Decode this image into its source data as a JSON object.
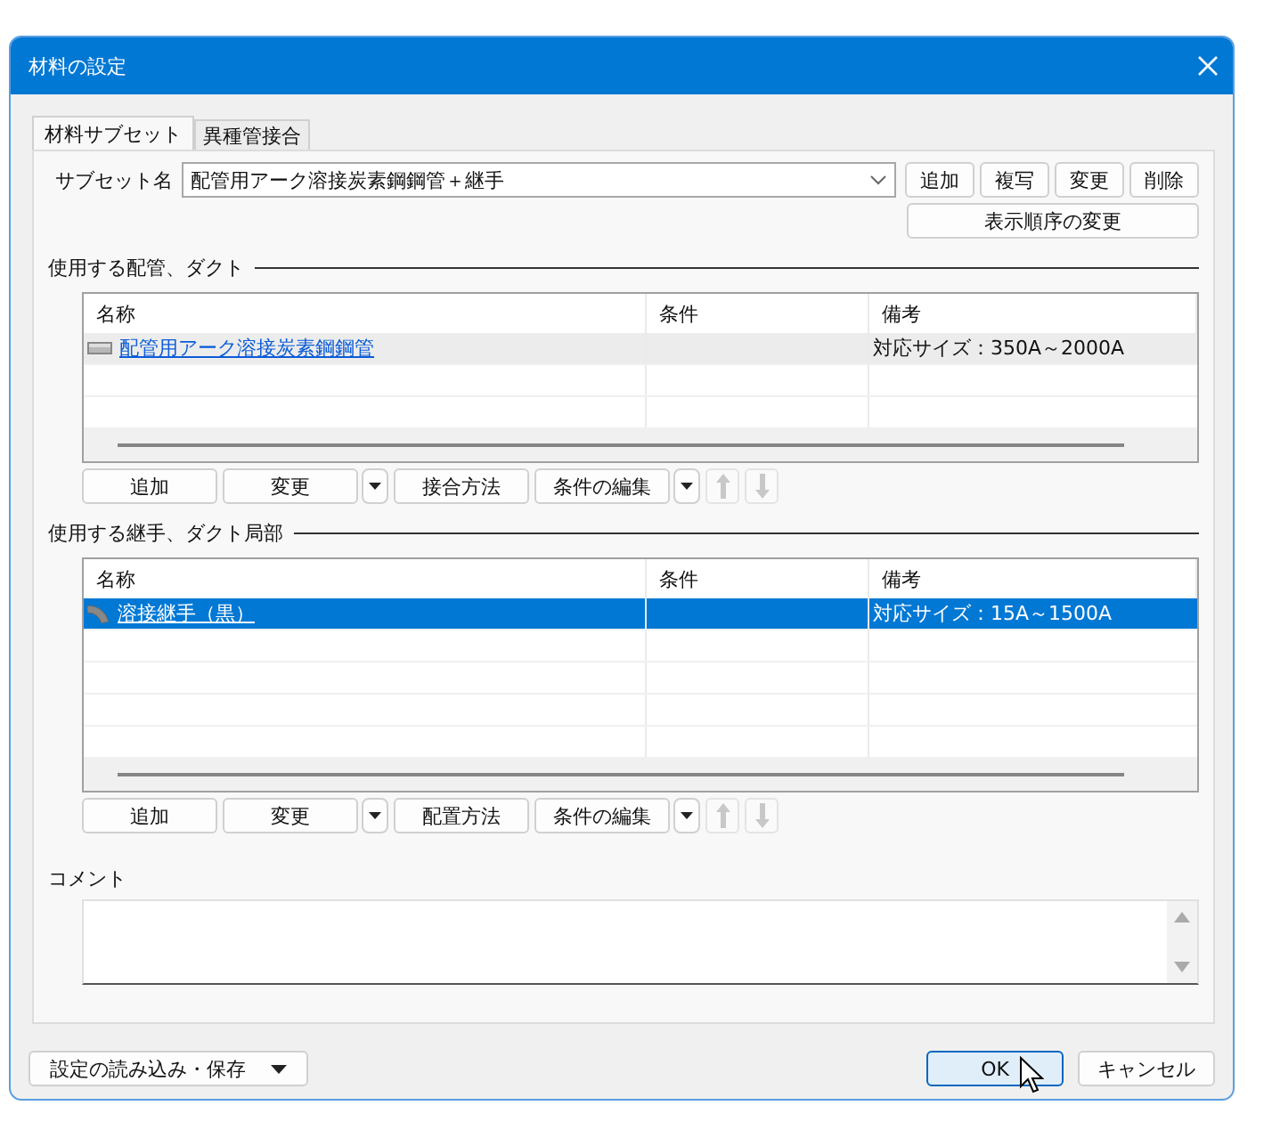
{
  "window": {
    "title": "材料の設定"
  },
  "tabs": [
    {
      "label": "材料サブセット",
      "selected": true
    },
    {
      "label": "異種管接合",
      "selected": false
    }
  ],
  "subset": {
    "label": "サブセット名",
    "value": "配管用アーク溶接炭素鋼鋼管＋継手",
    "buttons": [
      "追加",
      "複写",
      "変更",
      "削除"
    ],
    "order_button": "表示順序の変更"
  },
  "sections": [
    {
      "title": "使用する配管、ダクト",
      "table": {
        "focused": false,
        "columns": [
          "名称",
          "条件",
          "備考"
        ],
        "rows": [
          {
            "kind": "pipe",
            "name": "配管用アーク溶接炭素鋼鋼管",
            "remark": "対応サイズ：350A～2000A",
            "selected": true
          }
        ]
      },
      "buttons": [
        {
          "kind": "button",
          "label": "追加"
        },
        {
          "kind": "split",
          "label": "変更"
        },
        {
          "kind": "button",
          "label": "接合方法"
        },
        {
          "kind": "split",
          "label": "条件の編集"
        },
        {
          "kind": "up",
          "disabled": true
        },
        {
          "kind": "down",
          "disabled": true
        }
      ]
    },
    {
      "title": "使用する継手、ダクト局部",
      "table": {
        "focused": true,
        "columns": [
          "名称",
          "条件",
          "備考"
        ],
        "rows": [
          {
            "kind": "elbow",
            "name": "溶接継手（黒）",
            "remark": "対応サイズ：15A～1500A",
            "selected": true
          }
        ]
      },
      "buttons": [
        {
          "kind": "button",
          "label": "追加"
        },
        {
          "kind": "split",
          "label": "変更"
        },
        {
          "kind": "button",
          "label": "配置方法"
        },
        {
          "kind": "split",
          "label": "条件の編集"
        },
        {
          "kind": "up",
          "disabled": true
        },
        {
          "kind": "down",
          "disabled": true
        }
      ]
    }
  ],
  "comment": {
    "label": "コメント"
  },
  "footer": {
    "menu_button": "設定の読み込み・保存",
    "buttons": [
      {
        "label": "OK",
        "default": true
      },
      {
        "label": "キャンセル",
        "default": false
      }
    ]
  }
}
